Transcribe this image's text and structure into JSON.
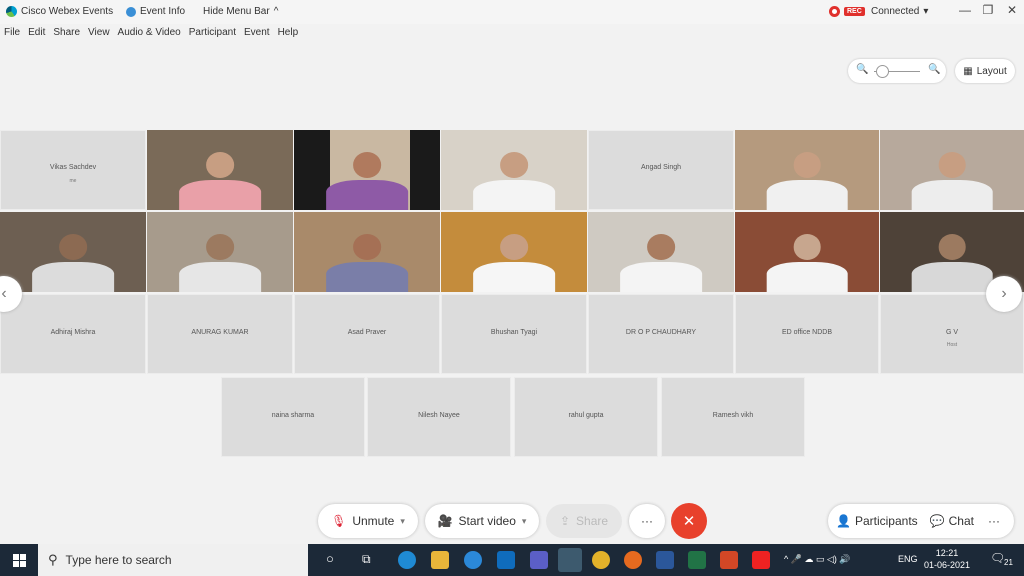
{
  "titlebar": {
    "app_title": "Cisco Webex Events",
    "event_info": "Event Info",
    "hide_menu": "Hide Menu Bar",
    "hide_menu_chevron": "^",
    "rec_badge": "REC",
    "status": "Connected",
    "status_arrow": "▾",
    "minimize": "—",
    "restore": "❐",
    "close": "✕"
  },
  "menu": [
    "File",
    "Edit",
    "Share",
    "View",
    "Audio & Video",
    "Participant",
    "Event",
    "Help"
  ],
  "view_controls": {
    "zoom_out": "🔍",
    "zoom_in": "🔍",
    "zoom_level": 0.1,
    "layout_icon": "▦",
    "layout_label": "Layout"
  },
  "nav": {
    "prev": "‹",
    "next": "›"
  },
  "participants": {
    "row1": [
      {
        "name": "Vikas Sachdev",
        "sub": "me",
        "video": false
      },
      {
        "name": "",
        "video": true
      },
      {
        "name": "",
        "video": true
      },
      {
        "name": "",
        "video": true
      },
      {
        "name": "Angad Singh",
        "video": false
      },
      {
        "name": "",
        "video": true
      },
      {
        "name": "",
        "video": true
      }
    ],
    "row3": [
      "Adhiraj Mishra",
      "ANURAG KUMAR",
      "Asad Praver",
      "Bhushan Tyagi",
      "DR O P CHAUDHARY",
      "ED office NDDB"
    ],
    "row3_last": {
      "name": "G V",
      "sub": "Host"
    },
    "row4": [
      "naina sharma",
      "Nilesh Nayee",
      "rahul gupta",
      "Ramesh vikh"
    ]
  },
  "controls": {
    "unmute_icon": "🎙",
    "unmute": "Unmute",
    "unmute_arrow": "▾",
    "video_icon": "🎥",
    "start_video": "Start video",
    "video_arrow": "▾",
    "share_icon": "⇪",
    "share": "Share",
    "more": "···",
    "end": "✕",
    "participants_icon": "👤",
    "participants": "Participants",
    "chat_icon": "💬",
    "chat": "Chat",
    "panel_more": "···"
  },
  "taskbar": {
    "search_icon": "⚲",
    "search_placeholder": "Type here to search",
    "cortana": "○",
    "taskview": "⧉",
    "lang": "ENG",
    "time": "12:21",
    "date": "01-06-2021",
    "notif_count": "21",
    "notif_icon": "🗨",
    "tray_icons": "^ 🎤 ☁ ▭ ◁) 🔊"
  },
  "colors": {
    "end_red": "#e8412c",
    "rec_red": "#e0302c",
    "taskbar": "#1c2938"
  }
}
